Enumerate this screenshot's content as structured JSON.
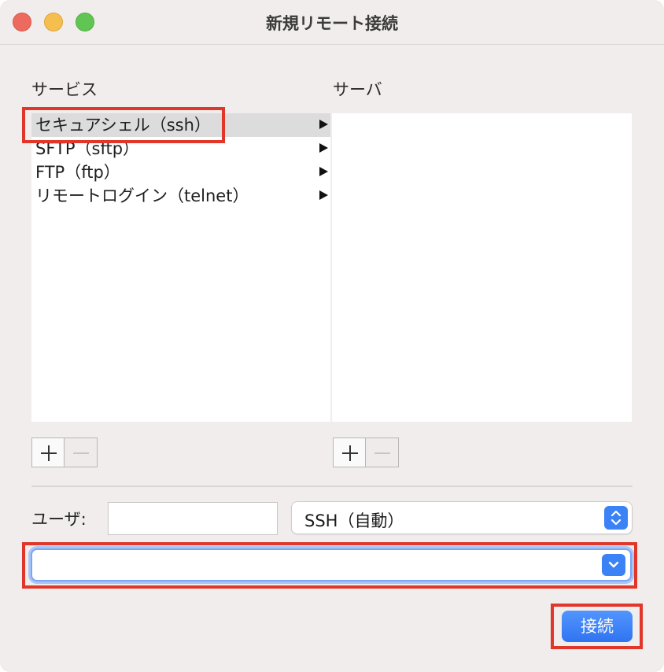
{
  "window": {
    "title": "新規リモート接続"
  },
  "services": {
    "label": "サービス",
    "items": [
      {
        "label": "セキュアシェル（ssh）",
        "selected": true
      },
      {
        "label": "SFTP（sftp）",
        "selected": false
      },
      {
        "label": "FTP（ftp）",
        "selected": false
      },
      {
        "label": "リモートログイン（telnet）",
        "selected": false
      }
    ]
  },
  "servers": {
    "label": "サーバ",
    "items": []
  },
  "user": {
    "label": "ユーザ:",
    "value": ""
  },
  "protocol": {
    "selected": "SSH（自動）"
  },
  "host": {
    "value": ""
  },
  "actions": {
    "connect_label": "接続"
  },
  "colors": {
    "accent": "#3a82f6",
    "highlight": "#e0372a",
    "selection": "#dcdcdc"
  },
  "icons": [
    "plus-icon",
    "minus-icon",
    "disclosure-arrow-icon",
    "chevron-up-down-icon",
    "chevron-down-icon"
  ]
}
